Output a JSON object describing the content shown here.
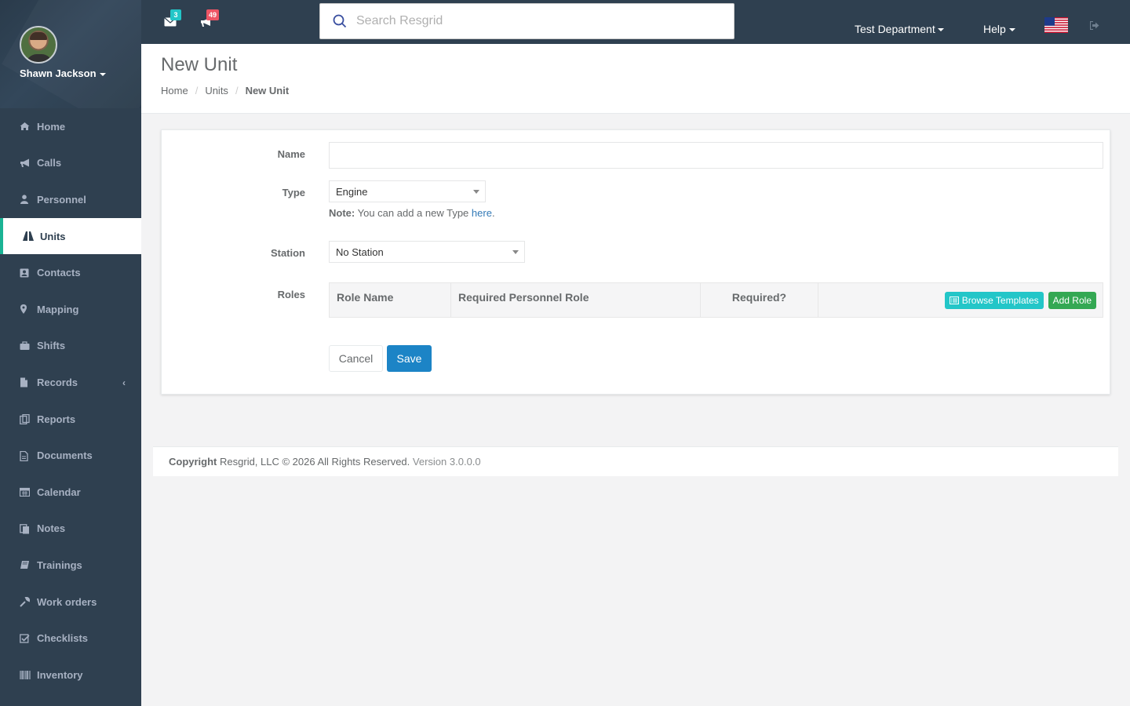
{
  "user": {
    "name": "Shawn Jackson"
  },
  "sidebar": {
    "items": [
      {
        "label": "Home",
        "icon": "home-icon"
      },
      {
        "label": "Calls",
        "icon": "bullhorn-icon"
      },
      {
        "label": "Personnel",
        "icon": "user-icon"
      },
      {
        "label": "Units",
        "icon": "road-icon",
        "active": true
      },
      {
        "label": "Contacts",
        "icon": "address-book-icon"
      },
      {
        "label": "Mapping",
        "icon": "map-marker-icon"
      },
      {
        "label": "Shifts",
        "icon": "briefcase-icon"
      },
      {
        "label": "Records",
        "icon": "file-icon",
        "expandable": true
      },
      {
        "label": "Reports",
        "icon": "reports-icon"
      },
      {
        "label": "Documents",
        "icon": "document-icon"
      },
      {
        "label": "Calendar",
        "icon": "calendar-icon"
      },
      {
        "label": "Notes",
        "icon": "notes-icon"
      },
      {
        "label": "Trainings",
        "icon": "book-icon"
      },
      {
        "label": "Work orders",
        "icon": "wrench-icon"
      },
      {
        "label": "Checklists",
        "icon": "checklist-icon"
      },
      {
        "label": "Inventory",
        "icon": "barcode-icon"
      }
    ]
  },
  "topbar": {
    "messages_count": "3",
    "calls_count": "49",
    "search_placeholder": "Search Resgrid",
    "department": "Test Department",
    "help": "Help"
  },
  "heading": {
    "title": "New Unit",
    "breadcrumb": [
      "Home",
      "Units",
      "New Unit"
    ]
  },
  "form": {
    "name_label": "Name",
    "name_value": "",
    "type_label": "Type",
    "type_value": "Engine",
    "note_bold": "Note:",
    "note_text": "You can add a new Type",
    "note_link": "here",
    "note_end": ".",
    "station_label": "Station",
    "station_value": "No Station",
    "roles_label": "Roles",
    "roles_columns": [
      "Role Name",
      "Required Personnel Role",
      "Required?"
    ],
    "browse_templates": "Browse Templates",
    "add_role": "Add Role",
    "cancel": "Cancel",
    "save": "Save"
  },
  "footer": {
    "copyright_bold": "Copyright",
    "copyright_text": "Resgrid, LLC © 2026 All Rights Reserved.",
    "version": "Version 3.0.0.0"
  },
  "colors": {
    "sidebar_bg": "#2f4050",
    "accent_teal": "#23c6c8",
    "badge_red": "#ed5565",
    "save_blue": "#1c84c6",
    "add_role_green": "#34a853"
  }
}
